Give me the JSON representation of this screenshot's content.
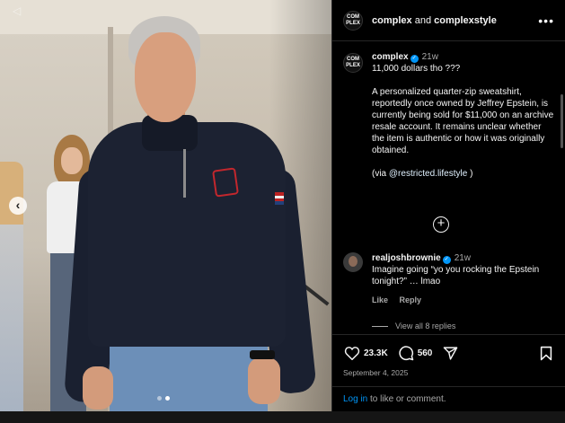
{
  "header": {
    "account_one": "complex",
    "conjunction": "and",
    "account_two": "complexstyle",
    "avatar_text_line1": "COM",
    "avatar_text_line2": "PLEX",
    "more_icon": "more-horizontal-icon"
  },
  "caption": {
    "username": "complex",
    "time": "21w",
    "line1": "11,000 dollars tho ???",
    "body": "A personalized quarter-zip sweatshirt, reportedly once owned by Jeffrey Epstein, is currently being sold for $11,000 on an archive resale account. It remains unclear whether the item is authentic or how it was originally obtained.",
    "via_prefix": "(via",
    "via_mention": "@restricted.lifestyle",
    "via_suffix": ")"
  },
  "reply": {
    "username": "realjoshbrownie",
    "time": "21w",
    "text": "Imagine going “yo you rocking the Epstein tonight?” … lmao",
    "like_label": "Like",
    "reply_label": "Reply",
    "view_all": "View all 8 replies"
  },
  "actions": {
    "likes": "23.3K",
    "comments": "560",
    "date": "September 4, 2025"
  },
  "login": {
    "link": "Log in",
    "text": " to like or comment."
  },
  "media": {
    "nav_prev": "‹",
    "dots_total": 2,
    "dots_active": 2
  },
  "colors": {
    "accent": "#0095f6",
    "background": "#000000",
    "muted_text": "#a8a8a8",
    "monogram": "#c2272d"
  }
}
